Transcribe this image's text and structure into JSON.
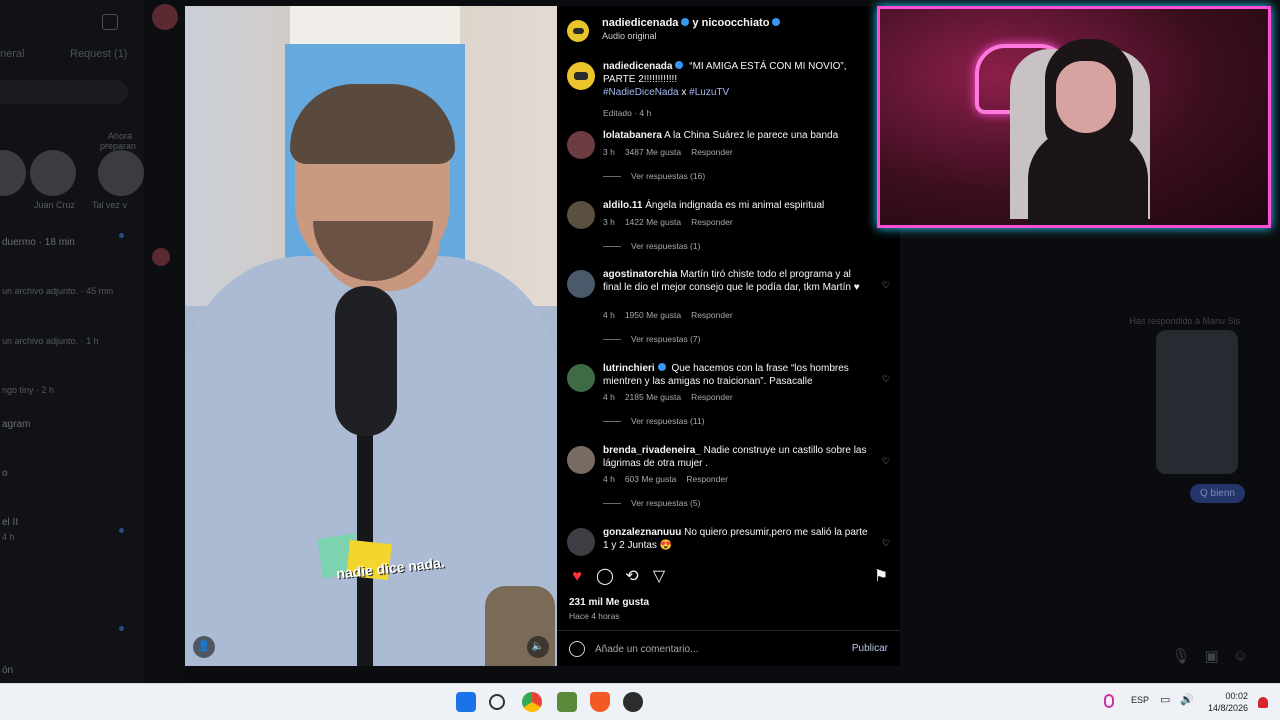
{
  "background": {
    "tabs": [
      "neral",
      "Request (1)"
    ],
    "stories": [
      "Juan Cruz",
      "Tal vez v"
    ],
    "notes": [
      "Ahora",
      "preparan"
    ],
    "threads": [
      {
        "text": "duermo",
        "time": "18 min"
      },
      {
        "text": "un archivo adjunto.",
        "time": "45 min"
      },
      {
        "text": "un archivo adjunto.",
        "time": "1 h"
      },
      {
        "text": "ngo tiny",
        "time": "2 h"
      },
      {
        "text": "agram",
        "time": ""
      },
      {
        "text": "o",
        "time": ""
      },
      {
        "text": "el II",
        "time": "4 h"
      },
      {
        "text": "ón",
        "time": ""
      }
    ],
    "replied_label": "Has respondido a Manu Sis",
    "reply_bubble": "Q bienn"
  },
  "post": {
    "audio_users": "nadiedicenada",
    "audio_collab": "y nicoocchiato",
    "audio_label": "Audio original",
    "caption_user": "nadiedicenada",
    "caption_text": "“MI AMIGA ESTÁ CON MI NOVIO”, PARTE 2!!!!!!!!!!!!",
    "hashtag1": "#NadieDiceNada",
    "hashtag_sep": "x",
    "hashtag2": "#LuzuTV",
    "edited": "Editado · 4 h",
    "video_logo": "nadie dice nada.",
    "likes": "231 mil Me gusta",
    "posted_ago": "Hace 4 horas",
    "comment_placeholder": "Añade un comentario...",
    "publish_label": "Publicar"
  },
  "comments": [
    {
      "user": "lolatabanera",
      "text": "A la China Suárez le parece una banda",
      "time": "3 h",
      "likes": "3487 Me gusta",
      "reply": "Responder",
      "replies": "Ver respuestas (16)"
    },
    {
      "user": "aldilo.11",
      "text": "Ángela indignada es mi animal espiritual",
      "time": "3 h",
      "likes": "1422 Me gusta",
      "reply": "Responder",
      "replies": "Ver respuestas (1)"
    },
    {
      "user": "agostinatorchia",
      "text": "Martín tiró chiste todo el programa y al final le dio el mejor consejo que le podía dar, tkm Martín ♥",
      "time": "4 h",
      "likes": "1950 Me gusta",
      "reply": "Responder",
      "replies": "Ver respuestas (7)"
    },
    {
      "user": "lutrinchieri",
      "text": "Que hacemos con la frase “los hombres mientren y las amigas no traicionan”. Pasacalle",
      "time": "4 h",
      "likes": "2185 Me gusta",
      "reply": "Responder",
      "replies": "Ver respuestas (11)"
    },
    {
      "user": "brenda_rivadeneira_",
      "text": "Nadie construye un castillo sobre las lágrimas de otra mujer .",
      "time": "4 h",
      "likes": "603 Me gusta",
      "reply": "Responder",
      "replies": "Ver respuestas (5)"
    },
    {
      "user": "gonzaleznanuuu",
      "text": "No quiero presumir,pero me salió la parte 1 y 2 Juntas 😍",
      "time": "",
      "likes": "",
      "reply": "",
      "replies": ""
    }
  ],
  "taskbar": {
    "lang": "ESP",
    "time": "00:02",
    "date": "14/8/2026"
  },
  "colors": {
    "accent_blue": "#3897f0",
    "heart_red": "#ff3040",
    "neon_pink": "#ff4fd8",
    "neon_cyan": "#27d4ff"
  }
}
